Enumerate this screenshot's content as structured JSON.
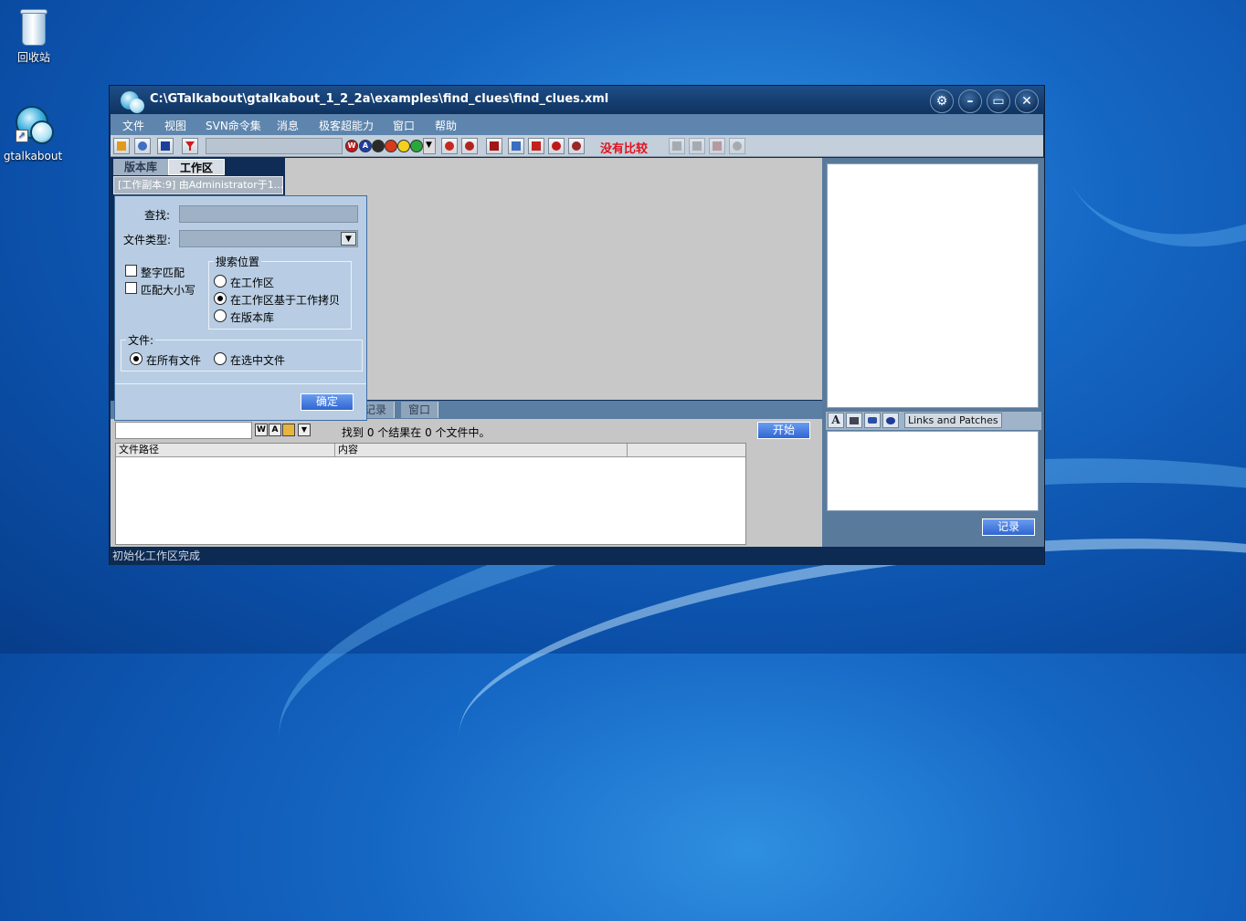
{
  "desktop": {
    "icons": [
      {
        "label": "回收站",
        "icon": "recycle-bin-icon"
      },
      {
        "label": "gtalkabout",
        "icon": "gtalkabout-shortcut-icon"
      }
    ]
  },
  "window": {
    "title": "C:\\GTalkabout\\gtalkabout_1_2_2a\\examples\\find_clues\\find_clues.xml",
    "controls": {
      "settings": "gear-icon",
      "minimize": "minimize-icon",
      "maximize": "maximize-icon",
      "close": "close-icon"
    }
  },
  "menu": [
    "文件",
    "视图",
    "SVN命令集",
    "消息",
    "极客超能力",
    "窗口",
    "帮助"
  ],
  "toolbar": {
    "compare_status": "没有比较",
    "ball_labels": [
      "W",
      "A",
      "",
      "",
      "",
      ""
    ]
  },
  "left_tabs": {
    "repo": "版本库",
    "workspace": "工作区",
    "working_copy": "[工作副本:9] 由Administrator于1..."
  },
  "dialog": {
    "find_label": "查找:",
    "find_value": "",
    "filetype_label": "文件类型:",
    "filetype_value": "",
    "whole_word": "整字匹配",
    "match_case": "匹配大小写",
    "search_location_legend": "搜索位置",
    "locations": [
      "在工作区",
      "在工作区基于工作拷贝",
      "在版本库"
    ],
    "selected_location": 1,
    "file_legend": "文件:",
    "file_options": [
      "在所有文件",
      "在选中文件"
    ],
    "selected_file_option": 0,
    "ok_label": "确定"
  },
  "bottom": {
    "tabs": [
      "记录",
      "窗口"
    ],
    "search_value": "",
    "result_text": "找到 0 个结果在 0 个文件中。",
    "start_label": "开始",
    "columns": [
      "文件路径",
      "内容",
      ""
    ]
  },
  "right": {
    "tools_label": "Links and Patches",
    "record_label": "记录"
  },
  "status": {
    "text": "初始化工作区完成"
  }
}
